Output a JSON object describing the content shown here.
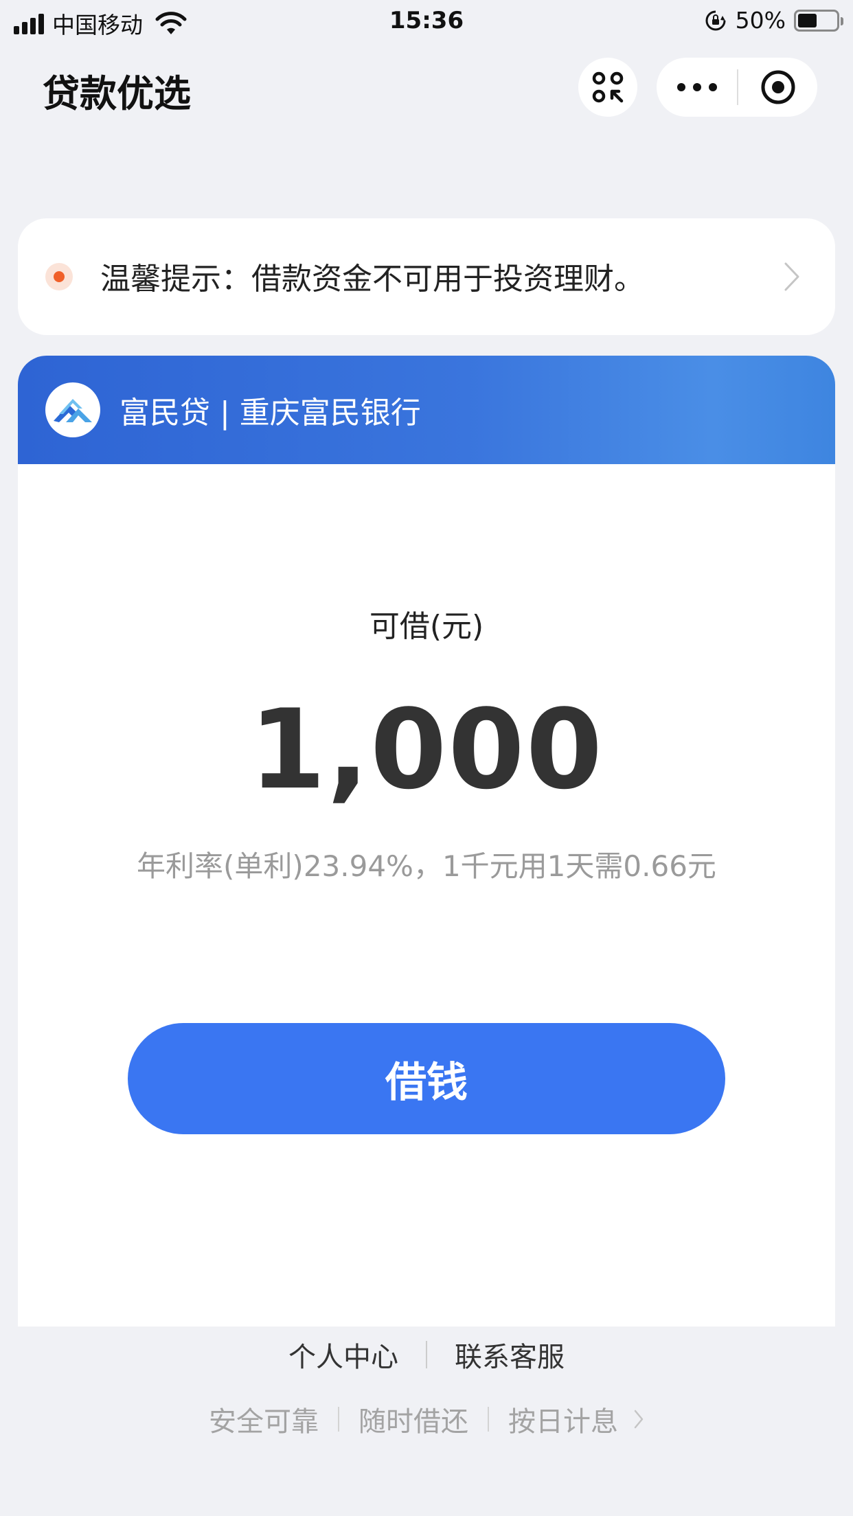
{
  "status_bar": {
    "carrier": "中国移动",
    "time": "15:36",
    "battery_percent": "50%",
    "battery_level": 0.5,
    "icons": [
      "signal-icon",
      "wifi-icon",
      "rotation-lock-icon",
      "battery-icon"
    ]
  },
  "nav": {
    "title": "贷款优选",
    "icons": [
      "scan-icon",
      "more-icon",
      "close-miniprogram-icon"
    ]
  },
  "notice": {
    "text": "温馨提示：借款资金不可用于投资理财。",
    "icons": [
      "notice-dot-icon",
      "chevron-right-icon"
    ]
  },
  "product": {
    "brand_name": "富民贷 | 重庆富民银行",
    "amount_label": "可借(元)",
    "amount_value": "1,000",
    "rate_info": "年利率(单利)23.94%，1千元用1天需0.66元",
    "borrow_button": "借钱",
    "icons": [
      "bank-logo-icon"
    ]
  },
  "footer": {
    "links": [
      "个人中心",
      "联系客服"
    ],
    "tagline": [
      "安全可靠",
      "随时借还",
      "按日计息"
    ]
  },
  "colors": {
    "primary_button": "#3a76f2",
    "header_gradient_start": "#2e64d4",
    "header_gradient_end": "#4a8ee6",
    "notice_dot": "#f0602a",
    "background": "#f0f1f5"
  }
}
